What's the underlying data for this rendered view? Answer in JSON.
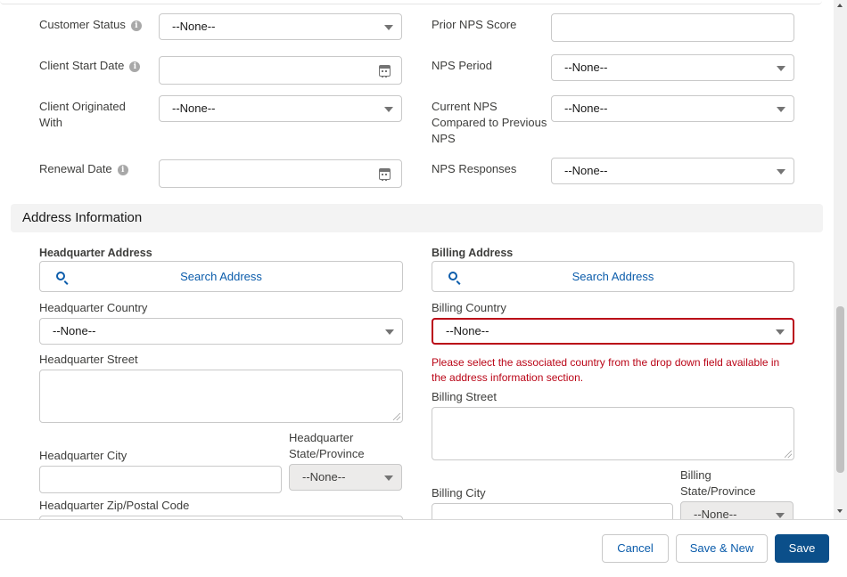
{
  "top_fields": {
    "customer_status": {
      "label": "Customer Status",
      "value": "--None--"
    },
    "client_start_date": {
      "label": "Client Start Date",
      "value": ""
    },
    "client_originated_with": {
      "label_line1": "Client Originated",
      "label_line2": "With",
      "value": "--None--"
    },
    "renewal_date": {
      "label": "Renewal Date",
      "value": ""
    },
    "prior_nps_score": {
      "label": "Prior NPS Score",
      "value": ""
    },
    "nps_period": {
      "label": "NPS Period",
      "value": "--None--"
    },
    "current_nps": {
      "label_line1": "Current NPS",
      "label_line2": "Compared to Previous",
      "label_line3": "NPS",
      "value": "--None--"
    },
    "nps_responses": {
      "label": "NPS Responses",
      "value": "--None--"
    },
    "info_glyph": "i"
  },
  "address_section": {
    "title": "Address Information",
    "hq": {
      "heading": "Headquarter Address",
      "search_label": "Search Address",
      "country_label": "Headquarter Country",
      "country_value": "--None--",
      "street_label": "Headquarter Street",
      "street_value": "",
      "city_label": "Headquarter City",
      "city_value": "",
      "state_label_line1": "Headquarter",
      "state_label_line2": "State/Province",
      "state_value": "--None--",
      "zip_label": "Headquarter Zip/Postal Code"
    },
    "billing": {
      "heading": "Billing Address",
      "search_label": "Search Address",
      "country_label": "Billing Country",
      "country_value": "--None--",
      "error_line1": "Please select the associated country from the drop down field available in",
      "error_line2": "the address information section.",
      "street_label": "Billing Street",
      "street_value": "",
      "city_label": "Billing City",
      "city_value": "",
      "state_label_line1": "Billing",
      "state_label_line2": "State/Province",
      "state_value": "--None--"
    }
  },
  "footer": {
    "cancel": "Cancel",
    "save_new": "Save & New",
    "save": "Save"
  },
  "colors": {
    "brand": "#0b4f8a",
    "link": "#0b5cab",
    "error": "#ba0517"
  }
}
